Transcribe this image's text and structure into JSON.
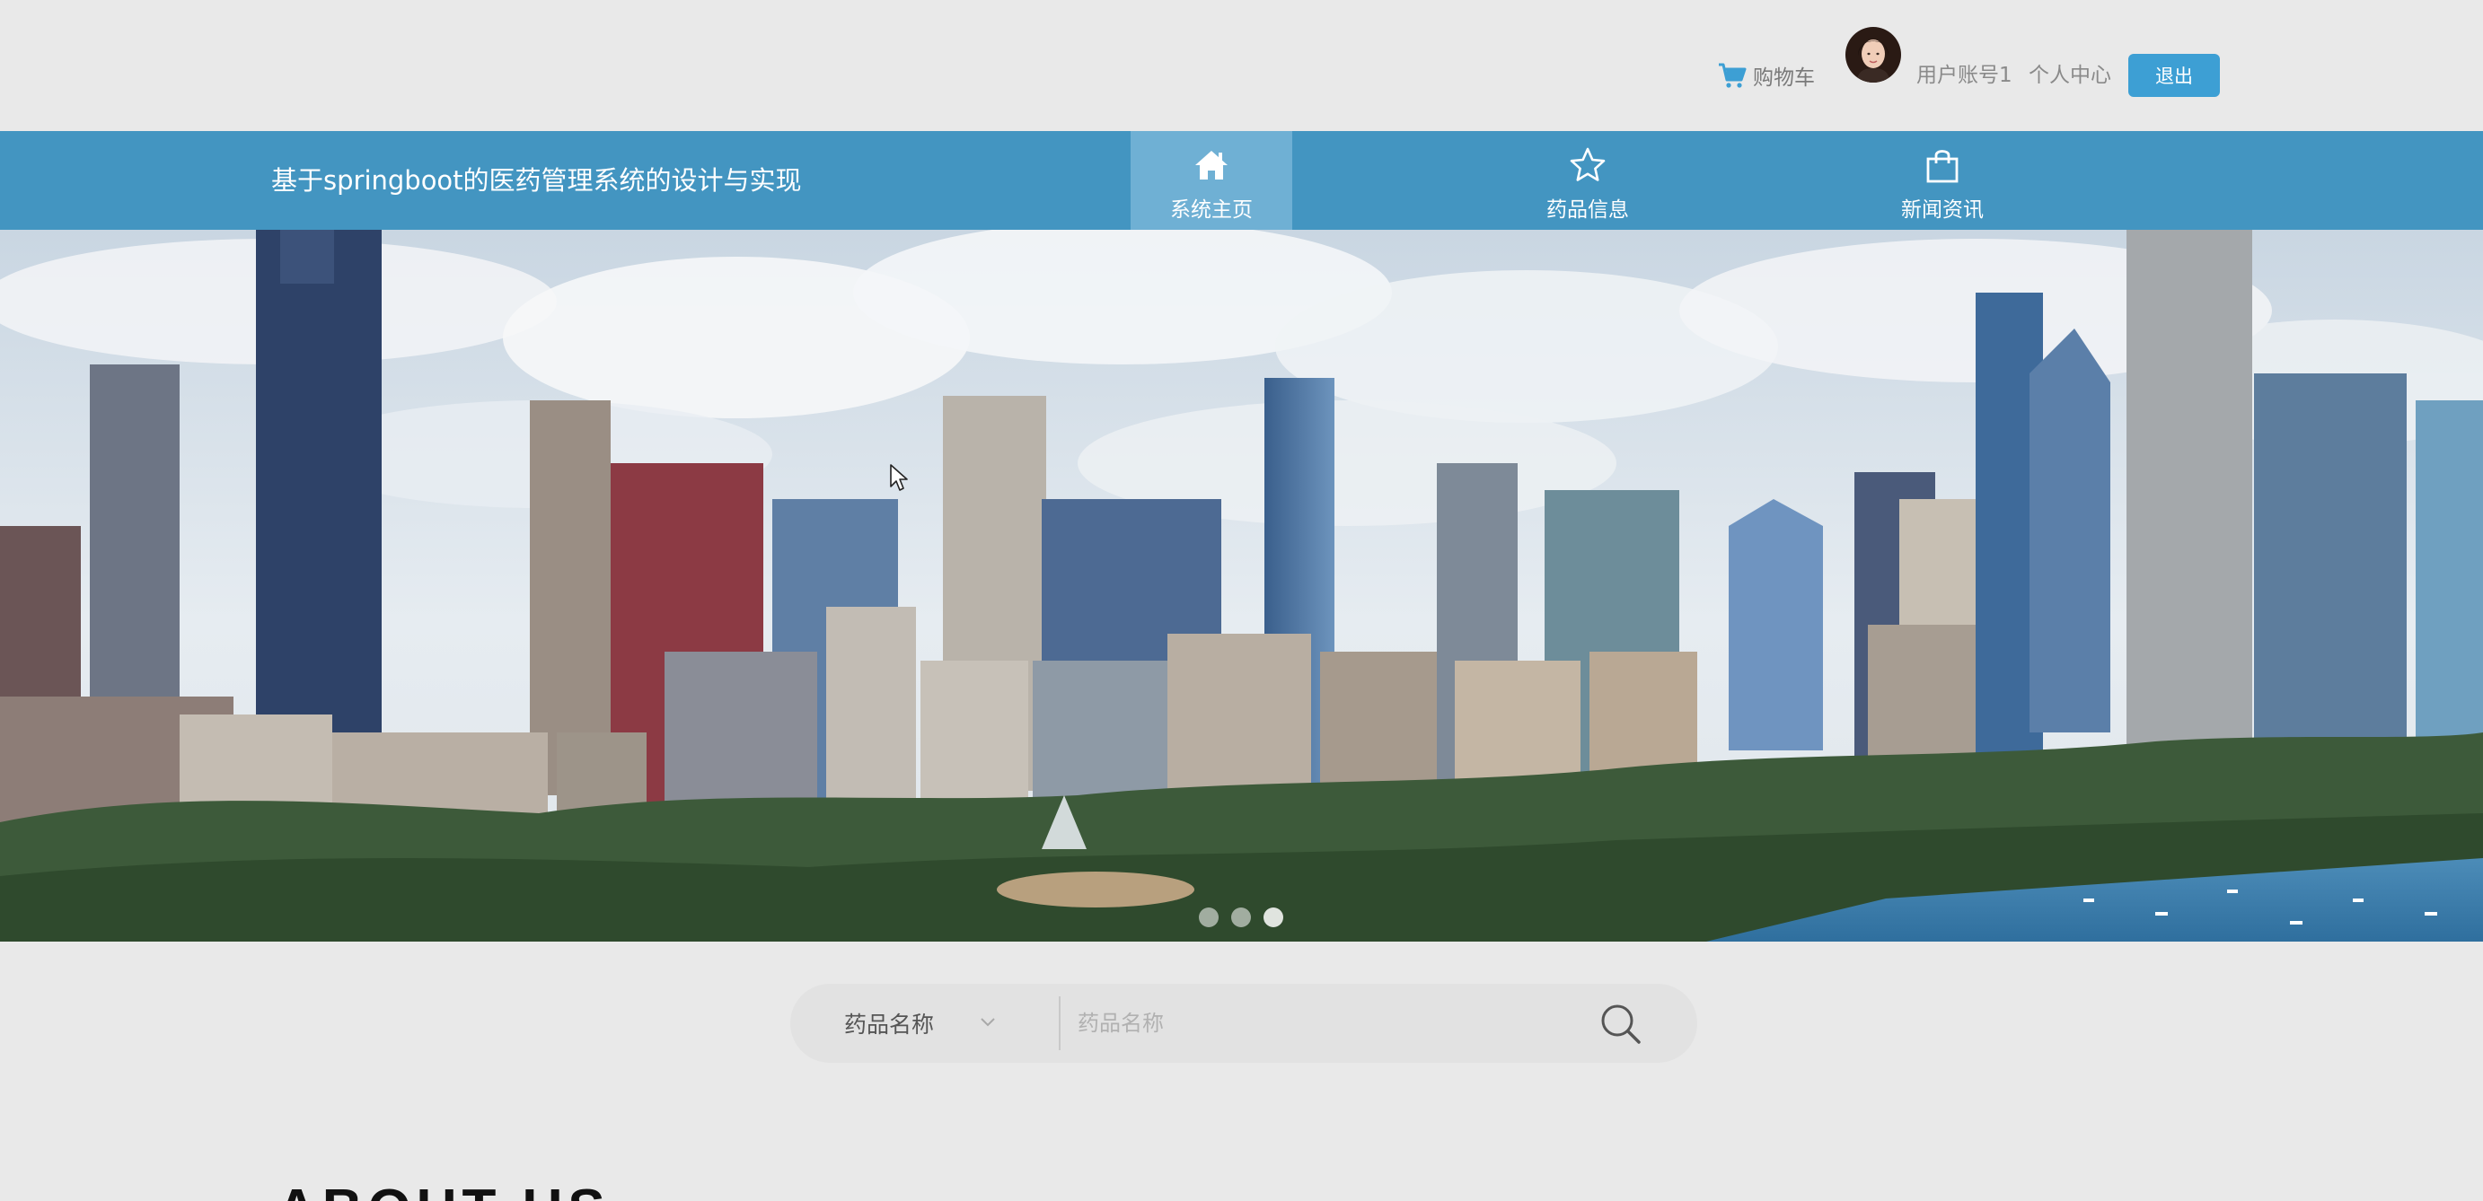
{
  "topbar": {
    "cart_label": "购物车",
    "username": "用户账号1",
    "user_center": "个人中心",
    "logout_label": "退出"
  },
  "nav": {
    "site_title": "基于springboot的医药管理系统的设计与实现",
    "items": [
      {
        "label": "系统主页",
        "icon": "home-icon",
        "active": true
      },
      {
        "label": "药品信息",
        "icon": "star-icon",
        "active": false
      },
      {
        "label": "新闻资讯",
        "icon": "shopping-bag-icon",
        "active": false
      }
    ]
  },
  "banner": {
    "slide_count": 3,
    "active_slide": 3
  },
  "search": {
    "field_selected": "药品名称",
    "placeholder": "药品名称",
    "value": ""
  },
  "about": {
    "heading": "ABOUT US"
  },
  "colors": {
    "navbar": "#4395c1",
    "nav_active": "#6fb0d4",
    "logout_button": "#3d9fd4",
    "page_background": "#e9e9e9"
  }
}
